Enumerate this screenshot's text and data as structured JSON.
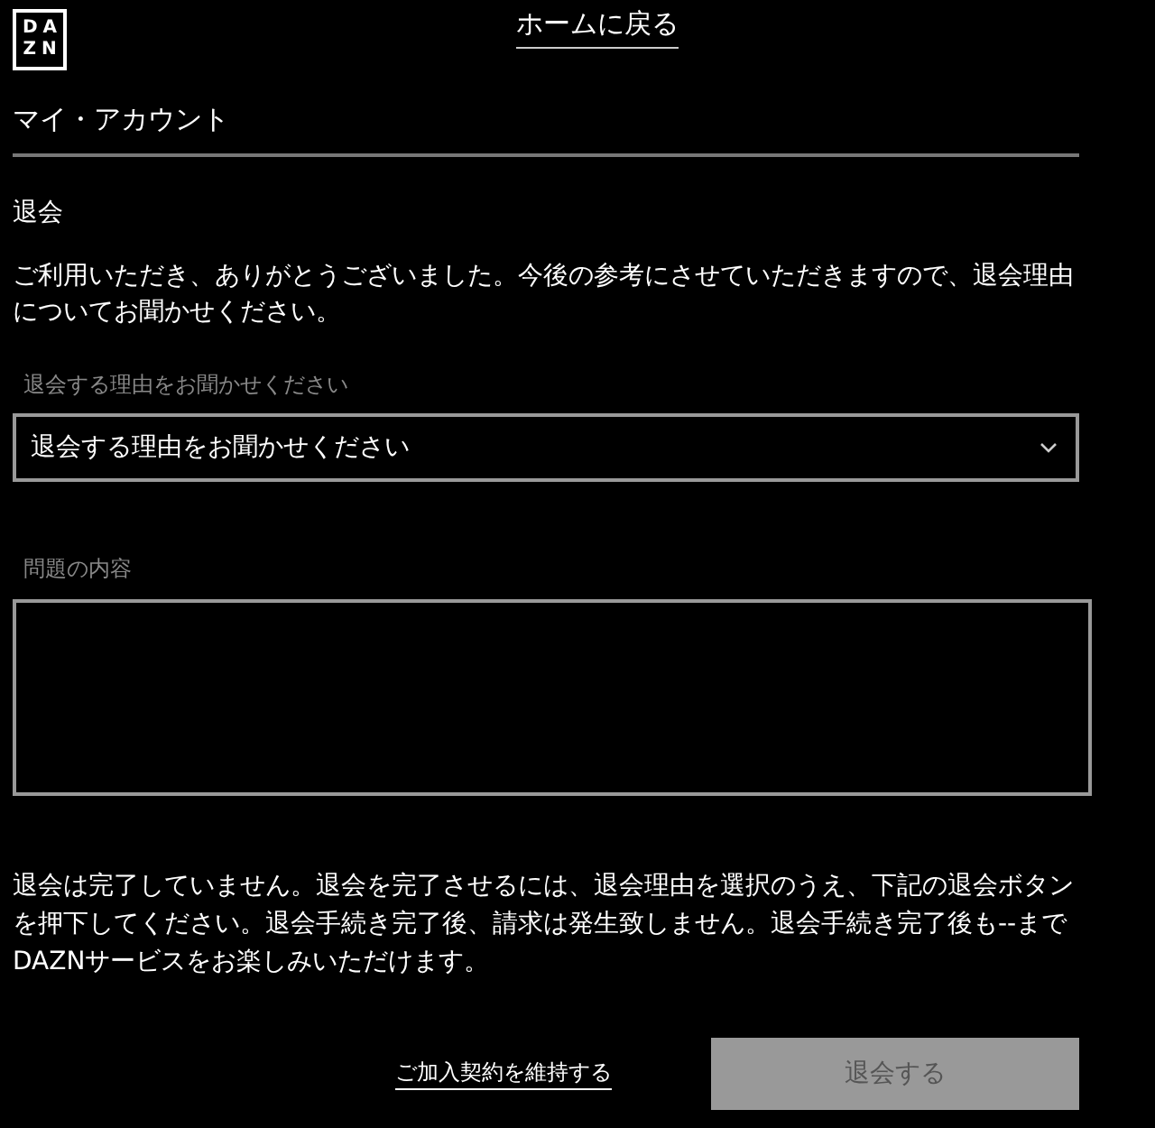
{
  "logo": {
    "top": "DA",
    "bottom": "ZN"
  },
  "home_link": "ホームに戻る",
  "page_title": "マイ・アカウント",
  "section_title": "退会",
  "intro": "ご利用いただき、ありがとうございました。今後の参考にさせていただきますので、退会理由についてお聞かせください。",
  "reason_field": {
    "label": "退会する理由をお聞かせください",
    "value": "退会する理由をお聞かせください"
  },
  "details_field": {
    "label": "問題の内容"
  },
  "notice": "退会は完了していません。退会を完了させるには、退会理由を選択のうえ、下記の退会ボタンを押下してください。退会手続き完了後、請求は発生致しません。退会手続き完了後も--までDAZNサービスをお楽しみいただけます。",
  "keep_link": "ご加入契約を維持する",
  "cancel_button": {
    "label": "退会する",
    "disabled": true
  }
}
